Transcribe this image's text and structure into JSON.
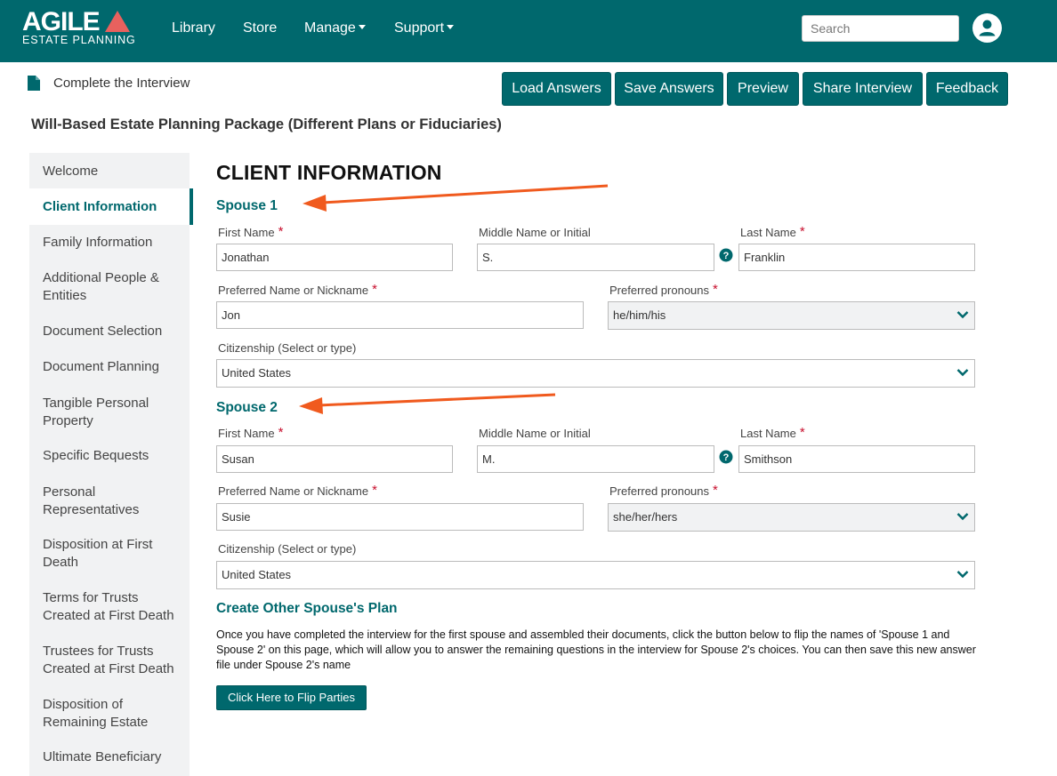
{
  "brand": {
    "name": "AGILE",
    "subtitle": "ESTATE PLANNING",
    "accent_color": "#e8615e",
    "primary_color": "#00686d"
  },
  "nav": {
    "links": [
      "Library",
      "Store",
      "Manage",
      "Support"
    ],
    "search_placeholder": "Search",
    "user_icon": "user-circle-icon"
  },
  "topbar": {
    "page_label": "Complete the Interview",
    "doc_icon": "document-icon",
    "buttons": [
      "Load Answers",
      "Save Answers",
      "Preview",
      "Share Interview",
      "Feedback"
    ]
  },
  "package_title": "Will-Based Estate Planning Package (Different Plans or Fiduciaries)",
  "sidebar": {
    "active_index": 1,
    "items": [
      "Welcome",
      "Client Information",
      "Family Information",
      "Additional People & Entities",
      "Document Selection",
      "Document Planning",
      "Tangible Personal Property",
      "Specific Bequests",
      "Personal Representatives",
      "Disposition at First Death",
      "Terms for Trusts Created at First Death",
      "Trustees for Trusts Created at First Death",
      "Disposition of Remaining Estate",
      "Ultimate Beneficiary"
    ]
  },
  "main": {
    "heading": "CLIENT INFORMATION",
    "labels": {
      "first_name": "First Name",
      "middle_name": "Middle Name or Initial",
      "last_name": "Last Name",
      "preferred_name": "Preferred Name or Nickname",
      "pronouns": "Preferred pronouns",
      "citizenship": "Citizenship (Select or type)"
    },
    "required_mark": "*",
    "spouse1": {
      "heading": "Spouse 1",
      "first_name": "Jonathan",
      "middle_name": "S.",
      "last_name": "Franklin",
      "preferred_name": "Jon",
      "pronouns": "he/him/his",
      "citizenship": "United States"
    },
    "spouse2": {
      "heading": "Spouse 2",
      "first_name": "Susan",
      "middle_name": "M.",
      "last_name": "Smithson",
      "preferred_name": "Susie",
      "pronouns": "she/her/hers",
      "citizenship": "United States"
    },
    "other_plan": {
      "heading": "Create Other Spouse's Plan",
      "text": "Once you have completed the interview for the first spouse and assembled their documents, click the button below to flip the names of 'Spouse 1 and Spouse 2' on this page, which will allow you to answer the remaining questions in the interview for Spouse 2's choices. You can then save this new answer file under Spouse 2's name",
      "button": "Click Here to Flip Parties"
    }
  },
  "annotation": {
    "arrow_color": "#f05a1e"
  }
}
